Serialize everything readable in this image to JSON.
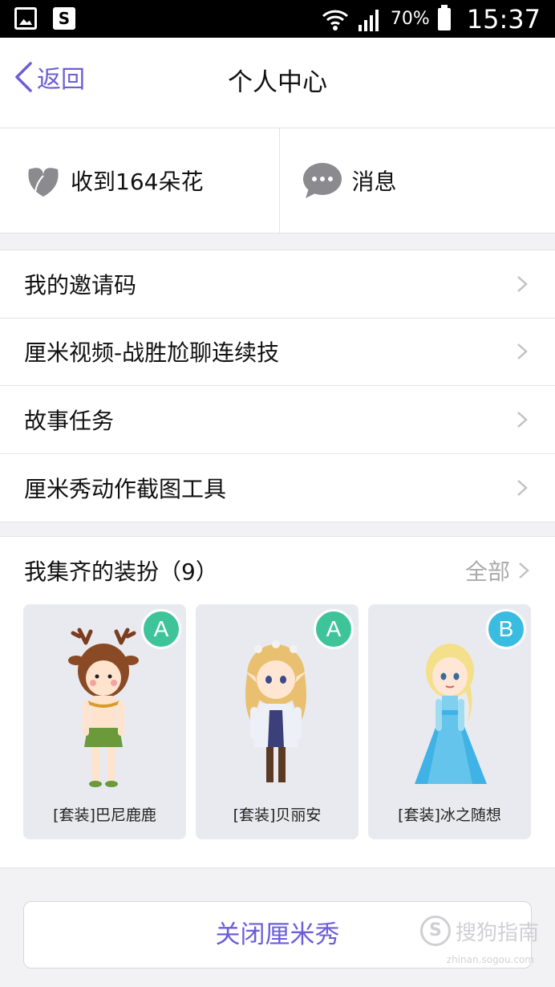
{
  "status_bar": {
    "battery": "70%",
    "time": "15:37"
  },
  "header": {
    "back_label": "返回",
    "title": "个人中心"
  },
  "stats": {
    "flowers_label": "收到164朵花",
    "messages_label": "消息"
  },
  "menu": {
    "items": [
      {
        "label": "我的邀请码"
      },
      {
        "label": "厘米视频-战胜尬聊连续技"
      },
      {
        "label": "故事任务"
      },
      {
        "label": "厘米秀动作截图工具"
      }
    ]
  },
  "outfits": {
    "title": "我集齐的装扮（9）",
    "all_label": "全部",
    "cards": [
      {
        "badge": "A",
        "label": "[套装]巴尼鹿鹿"
      },
      {
        "badge": "A",
        "label": "[套装]贝丽安"
      },
      {
        "badge": "B",
        "label": "[套装]冰之随想"
      }
    ]
  },
  "footer": {
    "close_button": "关闭厘米秀",
    "watermark": "搜狗指南",
    "watermark_logo": "S",
    "watermark_url": "zhinan.sogou.com"
  },
  "colors": {
    "accent": "#6b5ed8",
    "badge_a": "#3fc49a",
    "badge_b": "#38bde0"
  }
}
